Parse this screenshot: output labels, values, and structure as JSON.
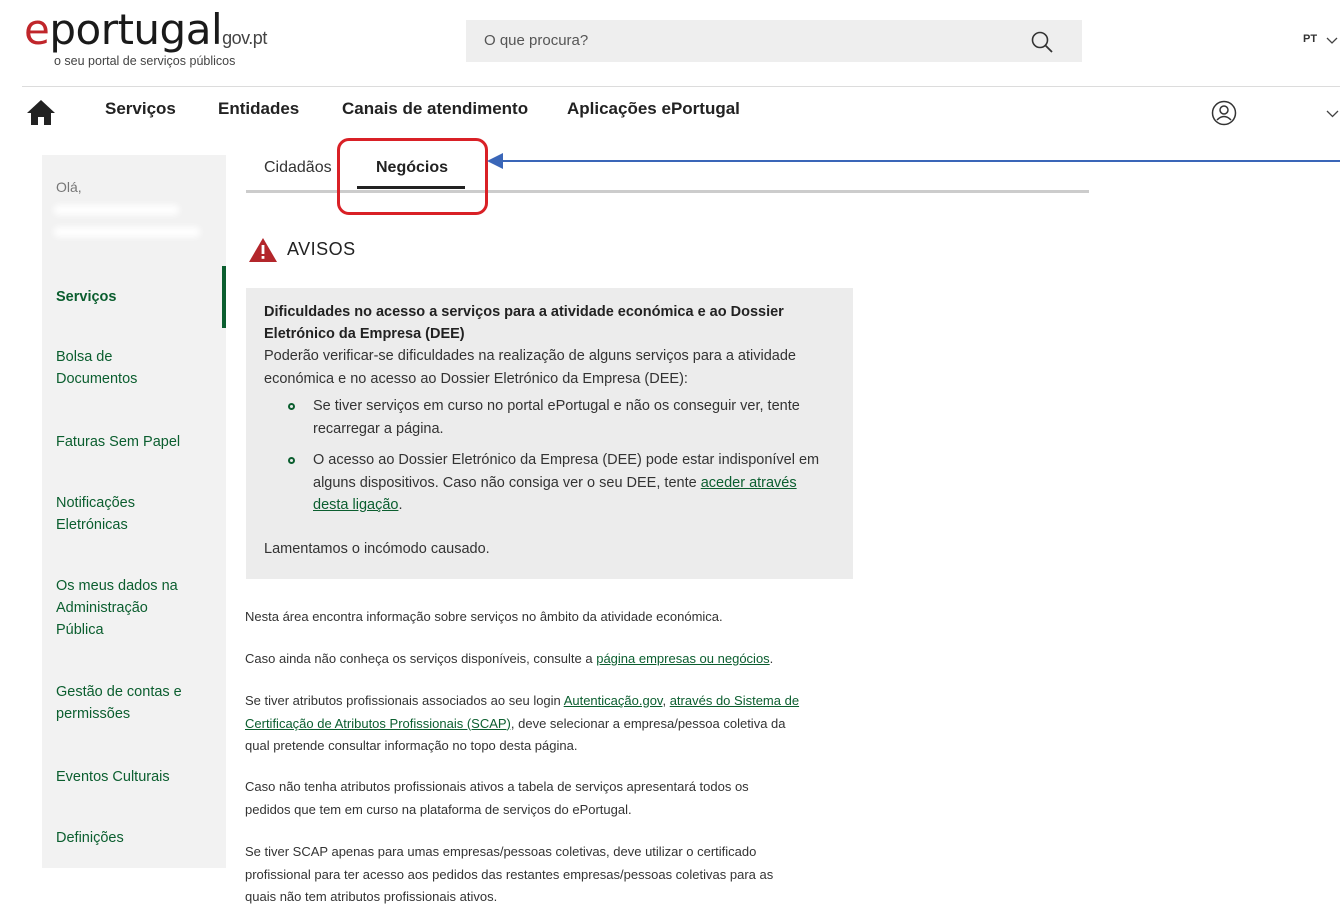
{
  "header": {
    "logo_main": "portugal",
    "logo_suffix": "gov.pt",
    "tagline": "o seu portal de serviços públicos",
    "search_placeholder": "O que procura?",
    "language": "PT"
  },
  "nav": {
    "items": [
      "Serviços",
      "Entidades",
      "Canais de atendimento",
      "Aplicações ePortugal"
    ]
  },
  "sidebar": {
    "greeting": "Olá,",
    "items": [
      {
        "label": "Serviços",
        "active": true
      },
      {
        "label": "Bolsa de Documentos"
      },
      {
        "label": "Faturas Sem Papel"
      },
      {
        "label": "Notificações Eletrónicas"
      },
      {
        "label": "Os meus dados na Administração Pública"
      },
      {
        "label": "Gestão de contas e permissões"
      },
      {
        "label": "Eventos Culturais"
      },
      {
        "label": "Definições"
      }
    ]
  },
  "tabs": [
    {
      "label": "Cidadãos"
    },
    {
      "label": "Negócios",
      "active": true
    }
  ],
  "avisos": {
    "title": "AVISOS",
    "notice_title": "Dificuldades no acesso a serviços para a atividade económica e ao Dossier Eletrónico da Empresa (DEE)",
    "notice_intro": "Poderão verificar-se dificuldades na realização de alguns serviços para a atividade económica e no acesso ao Dossier Eletrónico da Empresa (DEE):",
    "bullet_1": "Se tiver serviços em curso no portal ePortugal e não os conseguir ver, tente recarregar a página.",
    "bullet_2_text": "O acesso ao Dossier Eletrónico da Empresa (DEE) pode estar indisponível em alguns dispositivos. Caso não consiga ver o seu DEE, tente ",
    "bullet_2_link": "aceder através desta ligação",
    "bullet_2_end": ".",
    "closing": "Lamentamos o incómodo causado."
  },
  "content": {
    "p1": "Nesta área encontra informação sobre serviços no âmbito da atividade económica.",
    "p2_text": "Caso ainda não conheça os serviços disponíveis, consulte a ",
    "p2_link": "página empresas ou negócios",
    "p2_end": ".",
    "p3_text": "Se tiver atributos profissionais associados ao seu login ",
    "p3_link1": "Autenticação.gov",
    "p3_sep": ", ",
    "p3_link2": "através do Sistema de Certificação de Atributos Profissionais (SCAP)",
    "p3_end": ", deve selecionar a empresa/pessoa coletiva da qual pretende consultar informação no topo desta página.",
    "p4": "Caso não tenha atributos profissionais ativos a tabela de serviços apresentará todos os pedidos que tem em curso na plataforma de serviços do ePortugal.",
    "p5": "Se tiver SCAP apenas para umas empresas/pessoas coletivas, deve utilizar o certificado profissional para ter acesso aos pedidos das restantes empresas/pessoas coletivas para as quais não tem atributos profissionais ativos."
  },
  "colors": {
    "brand_green": "#0b5e2f",
    "highlight_red": "#d92026",
    "arrow_blue": "#3a66b8",
    "warning_red": "#b3262b"
  },
  "icons": [
    "search-icon",
    "chevron-down-icon",
    "home-icon",
    "user-icon",
    "warning-icon",
    "arrow-pointer"
  ]
}
